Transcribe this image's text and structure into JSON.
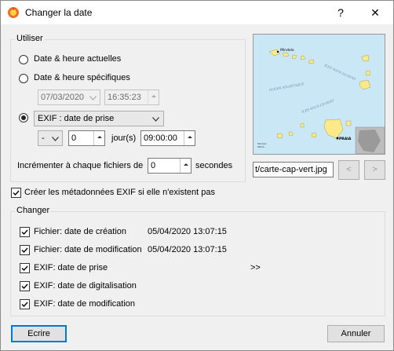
{
  "window": {
    "title": "Changer la date",
    "help_label": "?",
    "close_label": "✕"
  },
  "utiliser": {
    "legend": "Utiliser",
    "radio_current": "Date & heure actuelles",
    "radio_specific": "Date & heure spécifiques",
    "date_value": "07/03/2020",
    "time_value": "16:35:23",
    "exif_select": "EXIF : date de prise",
    "sign_select": "-",
    "days_value": "0",
    "days_label": "jour(s)",
    "offset_time": "09:00:00",
    "increment_label": "Incrémenter à chaque fichiers de",
    "increment_value": "0",
    "seconds_label": "secondes"
  },
  "preview": {
    "filename": "t/carte-cap-vert.jpg",
    "prev_label": "<",
    "next_label": ">"
  },
  "create_exif_label": "Créer les métadonnées EXIF si elle n'existent pas",
  "changer": {
    "legend": "Changer",
    "items": [
      {
        "label": "Fichier: date de création",
        "value": "05/04/2020 13:07:15"
      },
      {
        "label": "Fichier: date de modification",
        "value": "05/04/2020 13:07:15"
      },
      {
        "label": "EXIF: date de prise",
        "value": ">>"
      },
      {
        "label": "EXIF: date de digitalisation",
        "value": ""
      },
      {
        "label": "EXIF: date de modification",
        "value": ""
      }
    ]
  },
  "buttons": {
    "write": "Ecrire",
    "cancel": "Annuler"
  },
  "map_labels": {
    "mindelo": "Mindelo",
    "praia": "PRAIA"
  },
  "icons": {
    "app": "sun-app-icon",
    "map": "cape-verde-map-image"
  }
}
